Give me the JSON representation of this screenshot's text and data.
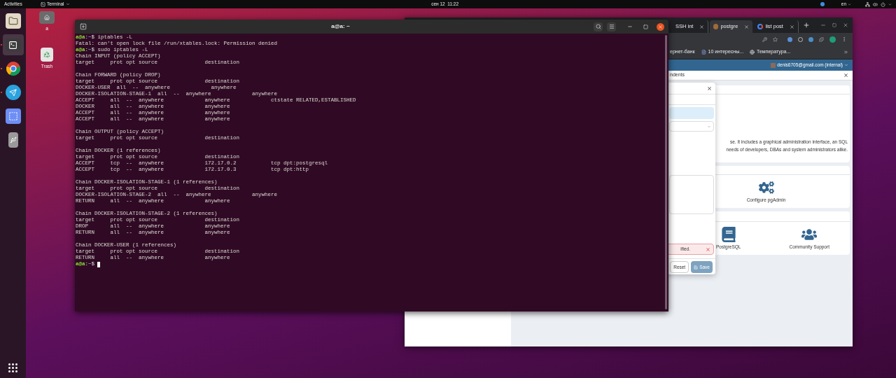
{
  "top_bar": {
    "activities": "Activities",
    "app_menu": "Terminal",
    "clock": "сен 12  11:22",
    "language": "en"
  },
  "dock": {
    "items": [
      {
        "kind": "files",
        "running": false,
        "active": false
      },
      {
        "kind": "terminal",
        "running": true,
        "active": true
      },
      {
        "kind": "chrome",
        "running": true,
        "active": false
      },
      {
        "kind": "telegram",
        "running": true,
        "active": false
      },
      {
        "kind": "screenshot",
        "running": false,
        "active": false
      },
      {
        "kind": "usb",
        "running": false,
        "active": false
      }
    ]
  },
  "desktop_icons": [
    {
      "kind": "home",
      "label": "a"
    },
    {
      "kind": "trash",
      "label": "Trash"
    }
  ],
  "terminal": {
    "title": "a@a: ~",
    "lines": [
      {
        "kind": "prompt",
        "user": "a@a",
        "sep": ":",
        "path": "~",
        "symbol": "$",
        "command": "iptables -L",
        "cursor": false
      },
      {
        "kind": "output",
        "text": "Fatal: can't open lock file /run/xtables.lock: Permission denied"
      },
      {
        "kind": "prompt",
        "user": "a@a",
        "sep": ":",
        "path": "~",
        "symbol": "$",
        "command": "sudo iptables -L",
        "cursor": false
      },
      {
        "kind": "output",
        "text": "Chain INPUT (policy ACCEPT)"
      },
      {
        "kind": "output",
        "text": "target     prot opt source               destination"
      },
      {
        "kind": "blank"
      },
      {
        "kind": "output",
        "text": "Chain FORWARD (policy DROP)"
      },
      {
        "kind": "output",
        "text": "target     prot opt source               destination"
      },
      {
        "kind": "output",
        "text": "DOCKER-USER  all  --  anywhere             anywhere"
      },
      {
        "kind": "output",
        "text": "DOCKER-ISOLATION-STAGE-1  all  --  anywhere             anywhere"
      },
      {
        "kind": "output",
        "text": "ACCEPT     all  --  anywhere             anywhere             ctstate RELATED,ESTABLISHED"
      },
      {
        "kind": "output",
        "text": "DOCKER     all  --  anywhere             anywhere"
      },
      {
        "kind": "output",
        "text": "ACCEPT     all  --  anywhere             anywhere"
      },
      {
        "kind": "output",
        "text": "ACCEPT     all  --  anywhere             anywhere"
      },
      {
        "kind": "blank"
      },
      {
        "kind": "output",
        "text": "Chain OUTPUT (policy ACCEPT)"
      },
      {
        "kind": "output",
        "text": "target     prot opt source               destination"
      },
      {
        "kind": "blank"
      },
      {
        "kind": "output",
        "text": "Chain DOCKER (1 references)"
      },
      {
        "kind": "output",
        "text": "target     prot opt source               destination"
      },
      {
        "kind": "output",
        "text": "ACCEPT     tcp  --  anywhere             172.17.0.2           tcp dpt:postgresql"
      },
      {
        "kind": "output",
        "text": "ACCEPT     tcp  --  anywhere             172.17.0.3           tcp dpt:http"
      },
      {
        "kind": "blank"
      },
      {
        "kind": "output",
        "text": "Chain DOCKER-ISOLATION-STAGE-1 (1 references)"
      },
      {
        "kind": "output",
        "text": "target     prot opt source               destination"
      },
      {
        "kind": "output",
        "text": "DOCKER-ISOLATION-STAGE-2  all  --  anywhere             anywhere"
      },
      {
        "kind": "output",
        "text": "RETURN     all  --  anywhere             anywhere"
      },
      {
        "kind": "blank"
      },
      {
        "kind": "output",
        "text": "Chain DOCKER-ISOLATION-STAGE-2 (1 references)"
      },
      {
        "kind": "output",
        "text": "target     prot opt source               destination"
      },
      {
        "kind": "output",
        "text": "DROP       all  --  anywhere             anywhere"
      },
      {
        "kind": "output",
        "text": "RETURN     all  --  anywhere             anywhere"
      },
      {
        "kind": "blank"
      },
      {
        "kind": "output",
        "text": "Chain DOCKER-USER (1 references)"
      },
      {
        "kind": "output",
        "text": "target     prot opt source               destination"
      },
      {
        "kind": "output",
        "text": "RETURN     all  --  anywhere             anywhere"
      },
      {
        "kind": "prompt",
        "user": "a@a",
        "sep": ":",
        "path": "~",
        "symbol": "$",
        "cursor": true
      }
    ]
  },
  "browser": {
    "tabs": [
      {
        "kind": "plain",
        "title": "SSH int",
        "selected": false
      },
      {
        "kind": "elephant",
        "title": "postgre",
        "selected": true
      },
      {
        "kind": "google",
        "title": "list post",
        "selected": false
      }
    ],
    "bookmarks": [
      {
        "kind": "text",
        "label": "ернет-банк"
      },
      {
        "kind": "page",
        "label": "10 интересны..."
      },
      {
        "kind": "globe",
        "label": "Температура..."
      }
    ],
    "account": "denis6705@gmail.com (internal)",
    "dialog_title": "ndents",
    "modal": {
      "alert": "ified.",
      "buttons": [
        {
          "kind": "reset",
          "label": "Reset",
          "disabled": false
        },
        {
          "kind": "save",
          "label": "Save",
          "disabled": true
        }
      ]
    },
    "welcome_text": [
      "se. It includes a graphical administration interface, an SQL",
      "needs of developers, DBAs and system administrators alike."
    ],
    "quick_links": [
      {
        "kind": "configure",
        "label": "Configure pgAdmin"
      }
    ],
    "links": [
      {
        "kind": "docs",
        "label": "PostgreSQL"
      },
      {
        "kind": "community",
        "label": "Community Support"
      }
    ]
  }
}
